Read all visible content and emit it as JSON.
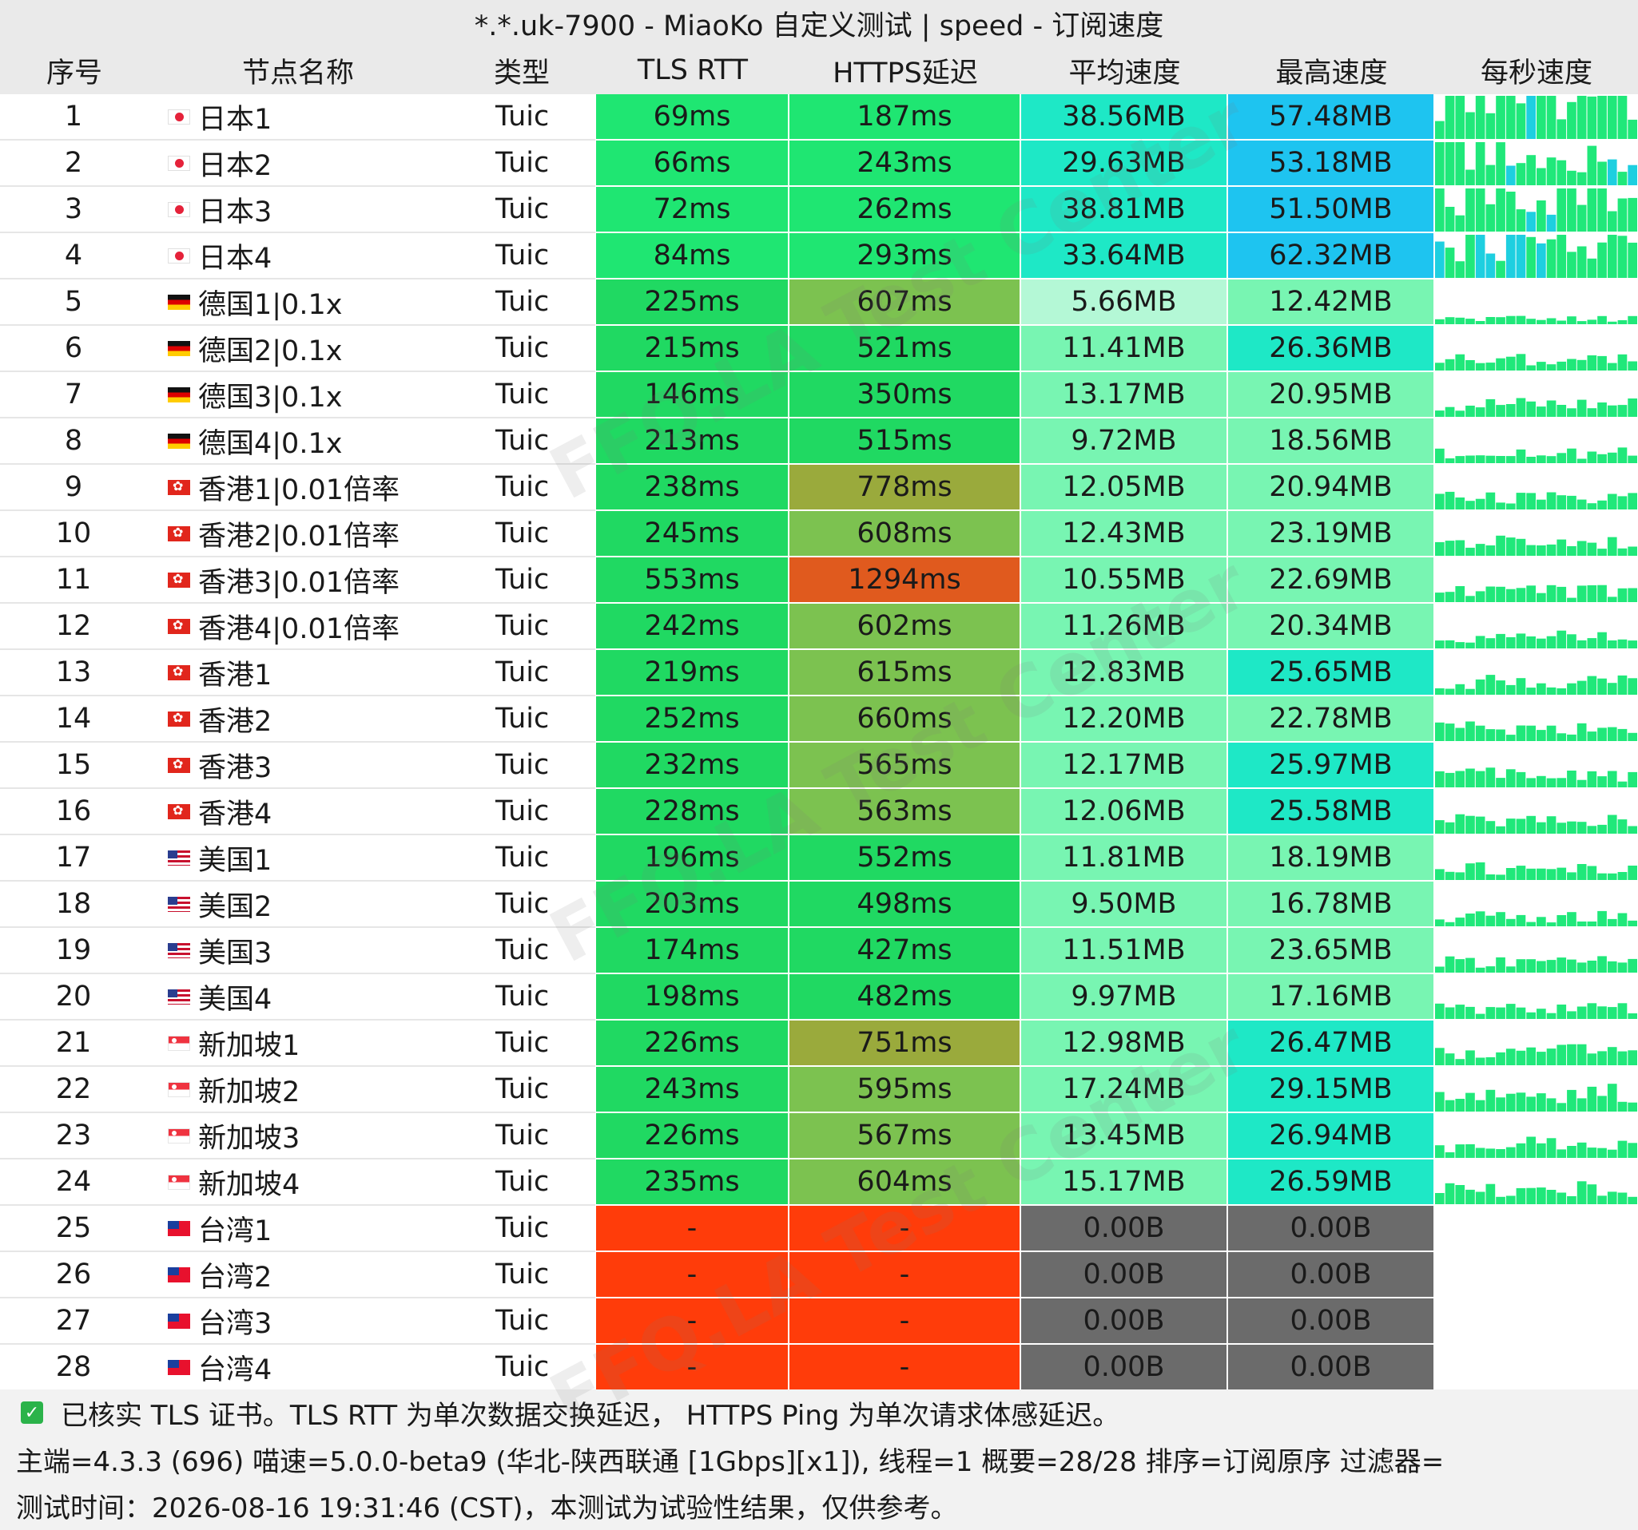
{
  "window": {
    "title": "*.*.uk-7900 - MiaoKo 自定义测试 | speed - 订阅速度"
  },
  "headers": {
    "index": "序号",
    "name": "节点名称",
    "type": "类型",
    "tls_rtt": "TLS RTT",
    "https_delay": "HTTPS延迟",
    "avg_speed": "平均速度",
    "max_speed": "最高速度",
    "per_second": "每秒速度"
  },
  "colors": {
    "tls_good": "#1fe672",
    "tls_mid": "#20d962",
    "tls_fail": "#ff3c0a",
    "https_good": "#20d962",
    "https_mid": "#7cc250",
    "https_slow": "#9aaa3c",
    "https_bad": "#e05a1e",
    "https_fail": "#ff3c0a",
    "speed_fast": "#1ee8c6",
    "speed_blue": "#1ec4f0",
    "speed_mid": "#78f5b2",
    "speed_low": "#b4f8d6",
    "speed_none": "#6b6b6b",
    "bar_green": "#20e87a",
    "bar_cyan": "#1ecfe0"
  },
  "rows": [
    {
      "idx": "1",
      "flag": "jp",
      "name": "日本1",
      "type": "Tuic",
      "tls": "69ms",
      "https": "187ms",
      "avg": "38.56MB",
      "max": "57.48MB"
    },
    {
      "idx": "2",
      "flag": "jp",
      "name": "日本2",
      "type": "Tuic",
      "tls": "66ms",
      "https": "243ms",
      "avg": "29.63MB",
      "max": "53.18MB"
    },
    {
      "idx": "3",
      "flag": "jp",
      "name": "日本3",
      "type": "Tuic",
      "tls": "72ms",
      "https": "262ms",
      "avg": "38.81MB",
      "max": "51.50MB"
    },
    {
      "idx": "4",
      "flag": "jp",
      "name": "日本4",
      "type": "Tuic",
      "tls": "84ms",
      "https": "293ms",
      "avg": "33.64MB",
      "max": "62.32MB"
    },
    {
      "idx": "5",
      "flag": "de",
      "name": "德国1|0.1x",
      "type": "Tuic",
      "tls": "225ms",
      "https": "607ms",
      "avg": "5.66MB",
      "max": "12.42MB"
    },
    {
      "idx": "6",
      "flag": "de",
      "name": "德国2|0.1x",
      "type": "Tuic",
      "tls": "215ms",
      "https": "521ms",
      "avg": "11.41MB",
      "max": "26.36MB"
    },
    {
      "idx": "7",
      "flag": "de",
      "name": "德国3|0.1x",
      "type": "Tuic",
      "tls": "146ms",
      "https": "350ms",
      "avg": "13.17MB",
      "max": "20.95MB"
    },
    {
      "idx": "8",
      "flag": "de",
      "name": "德国4|0.1x",
      "type": "Tuic",
      "tls": "213ms",
      "https": "515ms",
      "avg": "9.72MB",
      "max": "18.56MB"
    },
    {
      "idx": "9",
      "flag": "hk",
      "name": "香港1|0.01倍率",
      "type": "Tuic",
      "tls": "238ms",
      "https": "778ms",
      "avg": "12.05MB",
      "max": "20.94MB"
    },
    {
      "idx": "10",
      "flag": "hk",
      "name": "香港2|0.01倍率",
      "type": "Tuic",
      "tls": "245ms",
      "https": "608ms",
      "avg": "12.43MB",
      "max": "23.19MB"
    },
    {
      "idx": "11",
      "flag": "hk",
      "name": "香港3|0.01倍率",
      "type": "Tuic",
      "tls": "553ms",
      "https": "1294ms",
      "avg": "10.55MB",
      "max": "22.69MB"
    },
    {
      "idx": "12",
      "flag": "hk",
      "name": "香港4|0.01倍率",
      "type": "Tuic",
      "tls": "242ms",
      "https": "602ms",
      "avg": "11.26MB",
      "max": "20.34MB"
    },
    {
      "idx": "13",
      "flag": "hk",
      "name": "香港1",
      "type": "Tuic",
      "tls": "219ms",
      "https": "615ms",
      "avg": "12.83MB",
      "max": "25.65MB"
    },
    {
      "idx": "14",
      "flag": "hk",
      "name": "香港2",
      "type": "Tuic",
      "tls": "252ms",
      "https": "660ms",
      "avg": "12.20MB",
      "max": "22.78MB"
    },
    {
      "idx": "15",
      "flag": "hk",
      "name": "香港3",
      "type": "Tuic",
      "tls": "232ms",
      "https": "565ms",
      "avg": "12.17MB",
      "max": "25.97MB"
    },
    {
      "idx": "16",
      "flag": "hk",
      "name": "香港4",
      "type": "Tuic",
      "tls": "228ms",
      "https": "563ms",
      "avg": "12.06MB",
      "max": "25.58MB"
    },
    {
      "idx": "17",
      "flag": "us",
      "name": "美国1",
      "type": "Tuic",
      "tls": "196ms",
      "https": "552ms",
      "avg": "11.81MB",
      "max": "18.19MB"
    },
    {
      "idx": "18",
      "flag": "us",
      "name": "美国2",
      "type": "Tuic",
      "tls": "203ms",
      "https": "498ms",
      "avg": "9.50MB",
      "max": "16.78MB"
    },
    {
      "idx": "19",
      "flag": "us",
      "name": "美国3",
      "type": "Tuic",
      "tls": "174ms",
      "https": "427ms",
      "avg": "11.51MB",
      "max": "23.65MB"
    },
    {
      "idx": "20",
      "flag": "us",
      "name": "美国4",
      "type": "Tuic",
      "tls": "198ms",
      "https": "482ms",
      "avg": "9.97MB",
      "max": "17.16MB"
    },
    {
      "idx": "21",
      "flag": "sg",
      "name": "新加坡1",
      "type": "Tuic",
      "tls": "226ms",
      "https": "751ms",
      "avg": "12.98MB",
      "max": "26.47MB"
    },
    {
      "idx": "22",
      "flag": "sg",
      "name": "新加坡2",
      "type": "Tuic",
      "tls": "243ms",
      "https": "595ms",
      "avg": "17.24MB",
      "max": "29.15MB"
    },
    {
      "idx": "23",
      "flag": "sg",
      "name": "新加坡3",
      "type": "Tuic",
      "tls": "226ms",
      "https": "567ms",
      "avg": "13.45MB",
      "max": "26.94MB"
    },
    {
      "idx": "24",
      "flag": "sg",
      "name": "新加坡4",
      "type": "Tuic",
      "tls": "235ms",
      "https": "604ms",
      "avg": "15.17MB",
      "max": "26.59MB"
    },
    {
      "idx": "25",
      "flag": "tw",
      "name": "台湾1",
      "type": "Tuic",
      "tls": "-",
      "https": "-",
      "avg": "0.00B",
      "max": "0.00B"
    },
    {
      "idx": "26",
      "flag": "tw",
      "name": "台湾2",
      "type": "Tuic",
      "tls": "-",
      "https": "-",
      "avg": "0.00B",
      "max": "0.00B"
    },
    {
      "idx": "27",
      "flag": "tw",
      "name": "台湾3",
      "type": "Tuic",
      "tls": "-",
      "https": "-",
      "avg": "0.00B",
      "max": "0.00B"
    },
    {
      "idx": "28",
      "flag": "tw",
      "name": "台湾4",
      "type": "Tuic",
      "tls": "-",
      "https": "-",
      "avg": "0.00B",
      "max": "0.00B"
    }
  ],
  "footer": {
    "line1": "已核实 TLS 证书。TLS RTT 为单次数据交换延迟， HTTPS Ping 为单次请求体感延迟。",
    "line2": "主端=4.3.3 (696) 喵速=5.0.0-beta9 (华北-陕西联通 [1Gbps][x1]), 线程=1 概要=28/28 排序=订阅原序 过滤器=",
    "line3": "测试时间：2026-08-16 19:31:46 (CST)，本测试为试验性结果，仅供参考。"
  },
  "watermark": "FFQ.LA Test Center"
}
